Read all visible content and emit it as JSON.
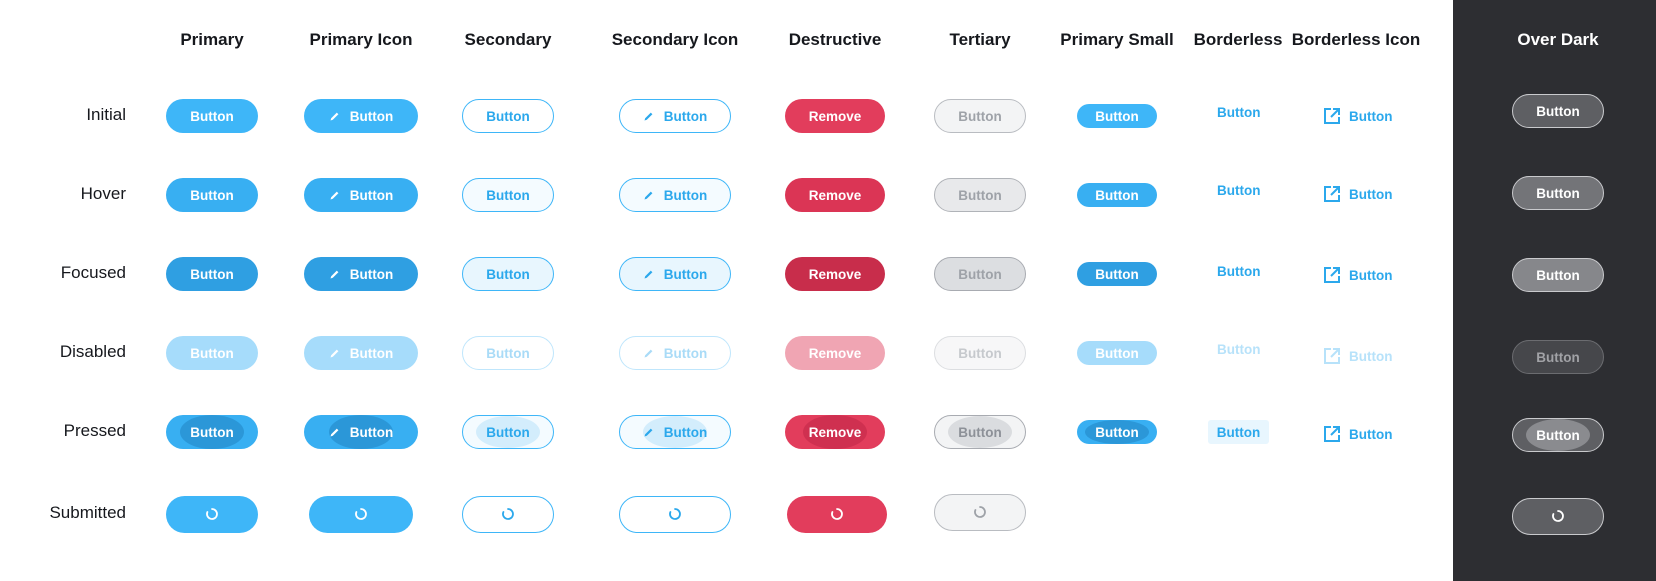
{
  "columns": [
    {
      "title": "Primary"
    },
    {
      "title": "Primary Icon"
    },
    {
      "title": "Secondary"
    },
    {
      "title": "Secondary Icon"
    },
    {
      "title": "Destructive"
    },
    {
      "title": "Tertiary"
    },
    {
      "title": "Primary Small"
    },
    {
      "title": "Borderless"
    },
    {
      "title": "Borderless Icon"
    },
    {
      "title": "Over Dark"
    }
  ],
  "rows": [
    {
      "label": "Initial"
    },
    {
      "label": "Hover"
    },
    {
      "label": "Focused"
    },
    {
      "label": "Disabled"
    },
    {
      "label": "Pressed"
    },
    {
      "label": "Submitted"
    }
  ],
  "labels": {
    "button": "Button",
    "remove": "Remove"
  },
  "icons": {
    "edit": "pencil-icon",
    "external": "external-link-icon",
    "loading": "spinner-icon"
  },
  "colors": {
    "primary": "#3eb6f8",
    "destructive": "#e23d5c",
    "dark_panel": "#2d2e32"
  }
}
